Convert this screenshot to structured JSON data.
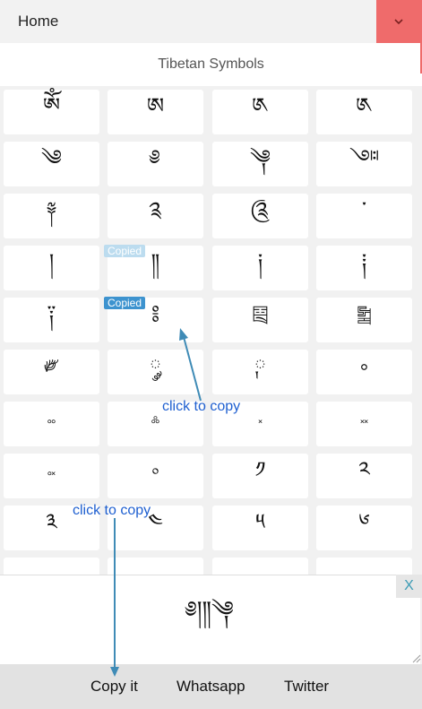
{
  "header": {
    "home_label": "Home",
    "dropdown_icon": "chevron-down-icon",
    "accent": "#ef6b6b"
  },
  "title": "Tibetan Symbols",
  "symbols": [
    "ༀ",
    "ཨ",
    "༁",
    "༁",
    "༄",
    "༅",
    "༆",
    "༇",
    "༈",
    "༉",
    "༊",
    "་",
    "།",
    "༎",
    "༏",
    "༐",
    "༑",
    "༔",
    "༕",
    "༖",
    "༗",
    "༘",
    "༙",
    "༚",
    "༛",
    "༜",
    "༝",
    "༞",
    "༟",
    "༠",
    "༡",
    "༢",
    "༣",
    "༤",
    "༥",
    "༦"
  ],
  "copied_badges": [
    "Copied",
    "Copied"
  ],
  "annotations": {
    "grid_hint": "click to copy",
    "bottom_hint": "click to copy"
  },
  "output": {
    "text": "༅།༎༆",
    "close_label": "X"
  },
  "bottom_bar": {
    "copy_label": "Copy it",
    "whatsapp_label": "Whatsapp",
    "twitter_label": "Twitter"
  }
}
